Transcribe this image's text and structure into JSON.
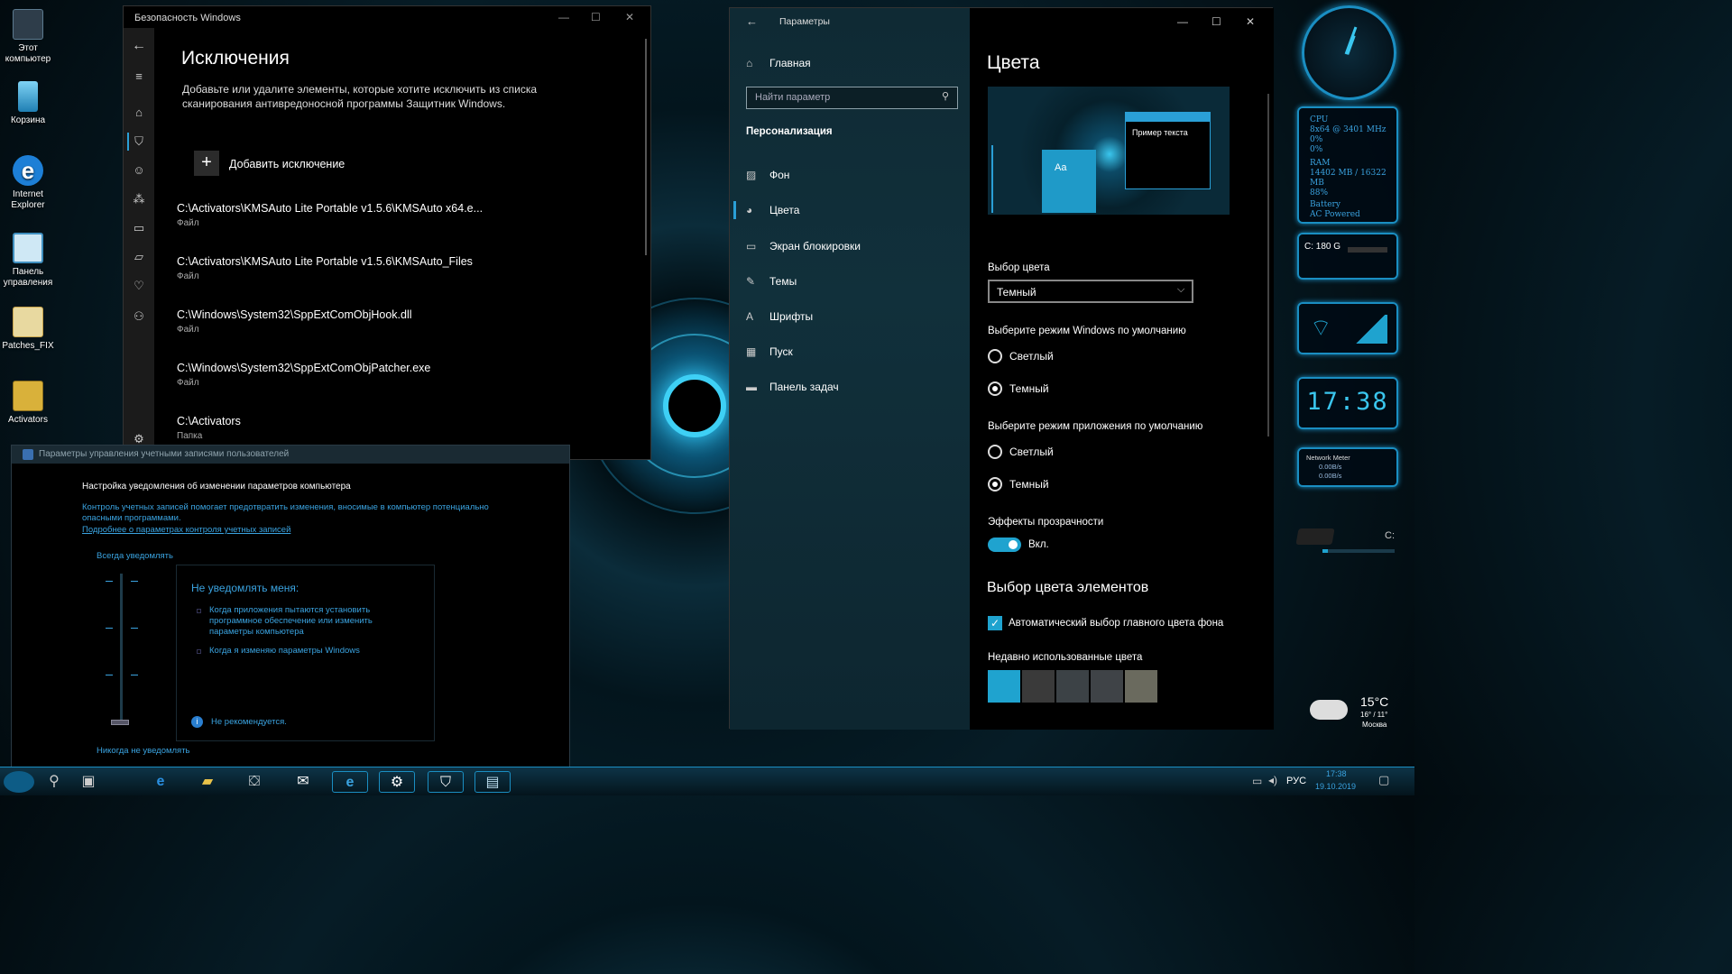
{
  "desktop": {
    "icons": [
      {
        "label": "Этот компьютер",
        "color": "#2e3d4a"
      },
      {
        "label": "Корзина",
        "color": "#2aa6d8"
      },
      {
        "label": "Internet Explorer",
        "color": "#1d7fd6"
      },
      {
        "label": "Панель управления",
        "color": "#3f8fbf"
      },
      {
        "label": "Patches_FIX",
        "color": "#c9a44a"
      },
      {
        "label": "Activators",
        "color": "#d9b13a"
      }
    ]
  },
  "security": {
    "window_title": "Безопасность Windows",
    "heading": "Исключения",
    "description": "Добавьте или удалите элементы, которые хотите исключить из списка сканирования антивредоносной программы Защитник Windows.",
    "add_label": "Добавить исключение",
    "exclusions": [
      {
        "path": "C:\\Activators\\KMSAuto Lite Portable v1.5.6\\KMSAuto x64.e...",
        "type": "Файл"
      },
      {
        "path": "C:\\Activators\\KMSAuto Lite Portable v1.5.6\\KMSAuto_Files",
        "type": "Файл"
      },
      {
        "path": "C:\\Windows\\System32\\SppExtComObjHook.dll",
        "type": "Файл"
      },
      {
        "path": "C:\\Windows\\System32\\SppExtComObjPatcher.exe",
        "type": "Файл"
      },
      {
        "path": "C:\\Activators",
        "type": "Папка"
      }
    ]
  },
  "uac": {
    "window_title": "Параметры управления учетными записями пользователей",
    "heading": "Настройка уведомления об изменении параметров компьютера",
    "info": "Контроль учетных записей помогает предотвратить изменения, вносимые в компьютер потенциально опасными программами.",
    "link": "Подробнее о параметрах контроля учетных записей",
    "top_label": "Всегда уведомлять",
    "bottom_label": "Никогда не уведомлять",
    "panel_title": "Не уведомлять меня:",
    "bullets": [
      "Когда приложения пытаются установить программное обеспечение или изменить параметры компьютера",
      "Когда я изменяю параметры Windows"
    ],
    "warning": "Не рекомендуется.",
    "slider_level": 0
  },
  "settings": {
    "window_title": "Параметры",
    "home": "Главная",
    "search_placeholder": "Найти параметр",
    "section": "Персонализация",
    "nav": [
      {
        "label": "Фон",
        "icon": "picture-icon"
      },
      {
        "label": "Цвета",
        "icon": "palette-icon",
        "active": true
      },
      {
        "label": "Экран блокировки",
        "icon": "lock-screen-icon"
      },
      {
        "label": "Темы",
        "icon": "brush-icon"
      },
      {
        "label": "Шрифты",
        "icon": "font-icon"
      },
      {
        "label": "Пуск",
        "icon": "start-icon"
      },
      {
        "label": "Панель задач",
        "icon": "taskbar-icon"
      }
    ],
    "page_title": "Цвета",
    "preview_sample": "Пример текста",
    "preview_tile": "Aa",
    "color_choice_label": "Выбор цвета",
    "color_choice_value": "Темный",
    "windows_mode_label": "Выберите режим Windows по умолчанию",
    "app_mode_label": "Выберите режим приложения по умолчанию",
    "light": "Светлый",
    "dark": "Темный",
    "transparency_label": "Эффекты прозрачности",
    "transparency_value": "Вкл.",
    "accent_heading": "Выбор цвета элементов",
    "auto_accent_label": "Автоматический выбор главного цвета фона",
    "recent_label": "Недавно использованные цвета",
    "recent_colors": [
      "#1fa3cf",
      "#3a3a3a",
      "#3c4246",
      "#3f4347",
      "#6a6a5e"
    ]
  },
  "gadgets": {
    "cpu_label": "CPU",
    "cpu_info": "8x64 @ 3401 MHz",
    "cpu_load1": "0%",
    "cpu_load2": "0%",
    "ram_label": "RAM",
    "ram_info": "14402 MB / 16322 MB",
    "ram_pct": "88%",
    "battery_label": "Battery",
    "battery_info": "AC Powered",
    "disk": "C: 180 G",
    "clock": "17:38",
    "net_title": "Network Meter",
    "net_up": "0.00B/s",
    "net_down": "0.00B/s",
    "drive_letter": "C:",
    "weather_temp": "15°C",
    "weather_range": "16° / 11°",
    "weather_city": "Москва"
  },
  "taskbar": {
    "lang": "РУС",
    "time": "17:38",
    "date": "19.10.2019"
  }
}
